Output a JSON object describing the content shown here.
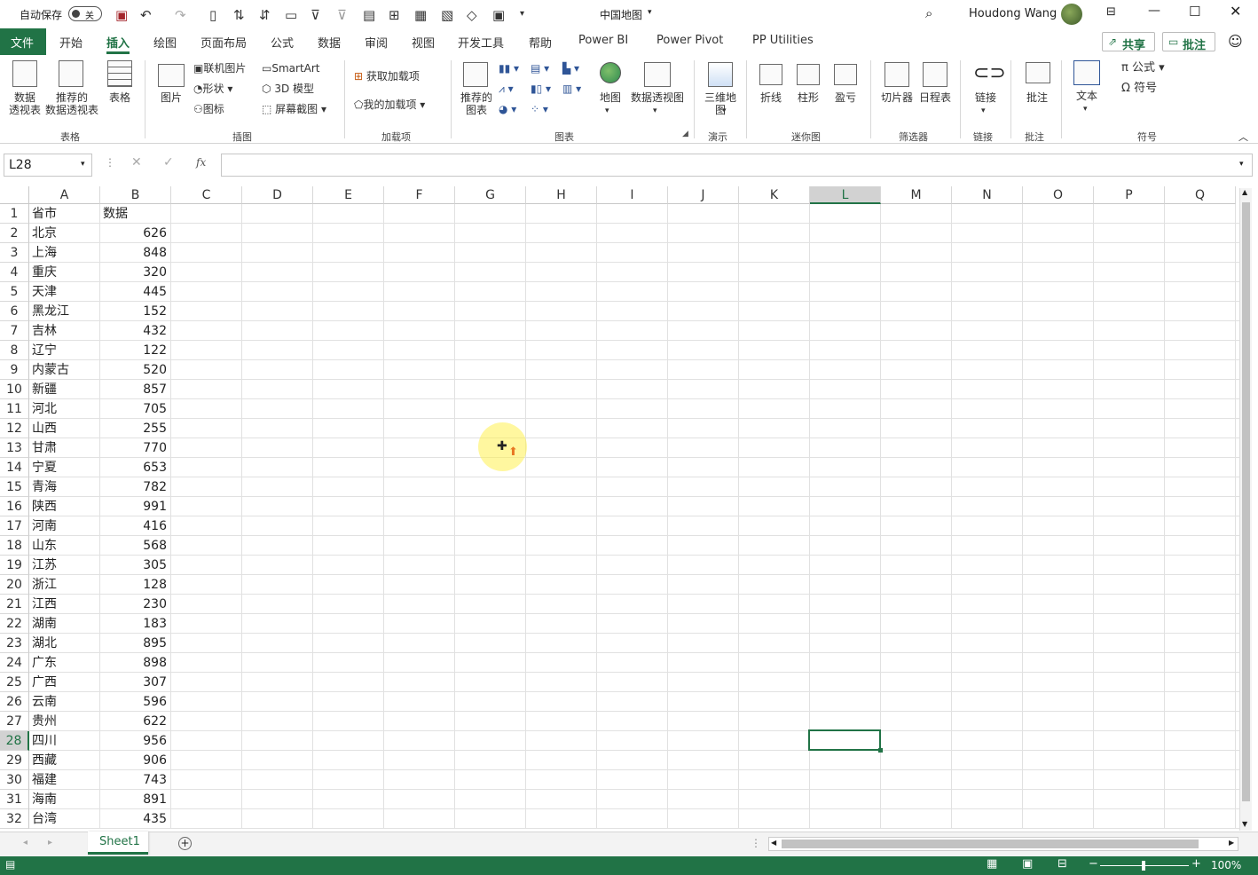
{
  "titlebar": {
    "autosave_label": "自动保存",
    "autosave_state": "关",
    "filename": "中国地图",
    "user": "Houdong Wang"
  },
  "tabs": [
    "文件",
    "开始",
    "插入",
    "绘图",
    "页面布局",
    "公式",
    "数据",
    "审阅",
    "视图",
    "开发工具",
    "帮助",
    "Power BI",
    "Power Pivot",
    "PP Utilities"
  ],
  "share_label": "共享",
  "comment_label": "批注",
  "ribbon": {
    "pivot_table": "数据\n透视表",
    "recommended_pivot": "推荐的\n数据透视表",
    "table": "表格",
    "picture": "图片",
    "online_pictures": "联机图片",
    "shapes": "形状",
    "icons": "图标",
    "smartart": "SmartArt",
    "model3d": "3D 模型",
    "screenshot": "屏幕截图",
    "get_addins": "获取加载项",
    "my_addins": "我的加载项",
    "recommended_charts": "推荐的\n图表",
    "maps": "地图",
    "pivot_chart": "数据透视图",
    "map3d": "三维地\n图",
    "spark_line": "折线",
    "spark_column": "柱形",
    "spark_winloss": "盈亏",
    "slicer": "切片器",
    "timeline": "日程表",
    "link": "链接",
    "comment": "批注",
    "text": "文本",
    "equation": "公式",
    "symbol": "符号",
    "groups": {
      "tables": "表格",
      "illustrations": "插图",
      "addins": "加载项",
      "charts": "图表",
      "tours": "演示",
      "sparklines": "迷你图",
      "filters": "筛选器",
      "links": "链接",
      "comments": "批注",
      "symbols": "符号"
    }
  },
  "formula_bar": {
    "name_box": "L28",
    "fx": "fx",
    "value": ""
  },
  "columns": [
    "A",
    "B",
    "C",
    "D",
    "E",
    "F",
    "G",
    "H",
    "I",
    "J",
    "K",
    "L",
    "M",
    "N",
    "O",
    "P",
    "Q"
  ],
  "rows": [
    [
      "省市",
      "数据"
    ],
    [
      "北京",
      "626"
    ],
    [
      "上海",
      "848"
    ],
    [
      "重庆",
      "320"
    ],
    [
      "天津",
      "445"
    ],
    [
      "黑龙江",
      "152"
    ],
    [
      "吉林",
      "432"
    ],
    [
      "辽宁",
      "122"
    ],
    [
      "内蒙古",
      "520"
    ],
    [
      "新疆",
      "857"
    ],
    [
      "河北",
      "705"
    ],
    [
      "山西",
      "255"
    ],
    [
      "甘肃",
      "770"
    ],
    [
      "宁夏",
      "653"
    ],
    [
      "青海",
      "782"
    ],
    [
      "陕西",
      "991"
    ],
    [
      "河南",
      "416"
    ],
    [
      "山东",
      "568"
    ],
    [
      "江苏",
      "305"
    ],
    [
      "浙江",
      "128"
    ],
    [
      "江西",
      "230"
    ],
    [
      "湖南",
      "183"
    ],
    [
      "湖北",
      "895"
    ],
    [
      "广东",
      "898"
    ],
    [
      "广西",
      "307"
    ],
    [
      "云南",
      "596"
    ],
    [
      "贵州",
      "622"
    ],
    [
      "四川",
      "956"
    ],
    [
      "西藏",
      "906"
    ],
    [
      "福建",
      "743"
    ],
    [
      "海南",
      "891"
    ],
    [
      "台湾",
      "435"
    ]
  ],
  "sheet_tab": "Sheet1",
  "zoom": "100%",
  "colors": {
    "accent": "#217346"
  }
}
